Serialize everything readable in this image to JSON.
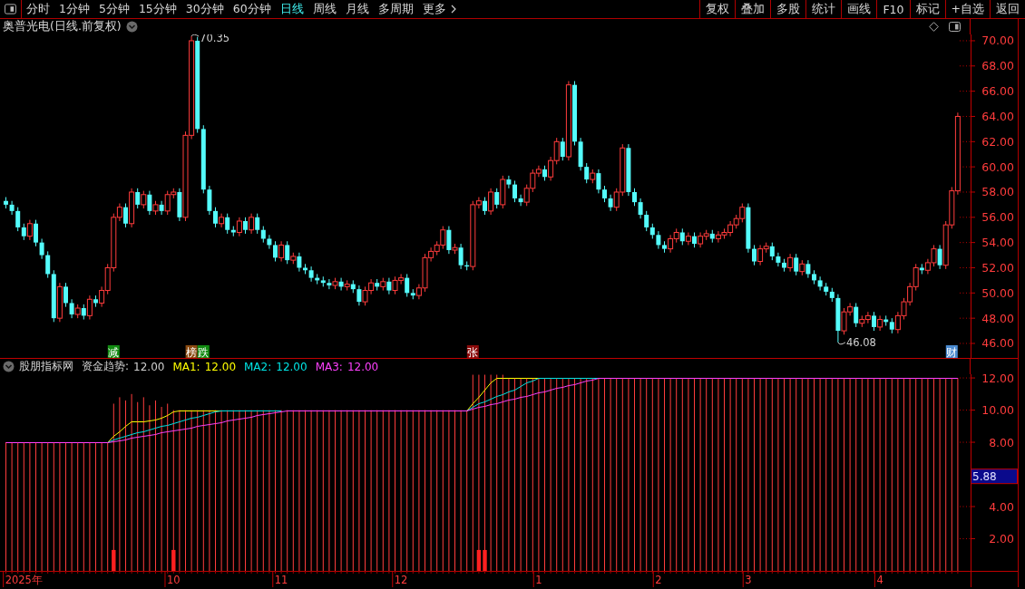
{
  "toolbar": {
    "periods": [
      {
        "label": "分时",
        "selected": false
      },
      {
        "label": "1分钟",
        "selected": false
      },
      {
        "label": "5分钟",
        "selected": false
      },
      {
        "label": "15分钟",
        "selected": false
      },
      {
        "label": "30分钟",
        "selected": false
      },
      {
        "label": "60分钟",
        "selected": false
      },
      {
        "label": "日线",
        "selected": true
      },
      {
        "label": "周线",
        "selected": false
      },
      {
        "label": "月线",
        "selected": false
      },
      {
        "label": "多周期",
        "selected": false
      },
      {
        "label": "更多",
        "selected": false
      }
    ],
    "buttons": [
      "复权",
      "叠加",
      "多股",
      "统计",
      "画线",
      "F10",
      "标记",
      "+自选",
      "返回"
    ]
  },
  "title": "奥普光电(日线.前复权)",
  "price_chart": {
    "chart_data": {
      "type": "candlestick",
      "ylim": [
        44.85,
        70.5
      ],
      "yticks": [
        {
          "value": 46,
          "label": "46.00"
        },
        {
          "value": 48,
          "label": "48.00"
        },
        {
          "value": 50,
          "label": "50.00"
        },
        {
          "value": 52,
          "label": "52.00"
        },
        {
          "value": 54,
          "label": "54.00"
        },
        {
          "value": 56,
          "label": "56.00"
        },
        {
          "value": 58,
          "label": "58.00"
        },
        {
          "value": 60,
          "label": "60.00"
        },
        {
          "value": 62,
          "label": "62.00"
        },
        {
          "value": 64,
          "label": "64.00"
        },
        {
          "value": 66,
          "label": "66.00"
        },
        {
          "value": 68,
          "label": "68.00"
        },
        {
          "value": 70,
          "label": "70.00"
        }
      ],
      "categories": [
        null,
        null,
        null,
        null,
        null,
        null,
        null,
        null,
        null,
        null,
        null,
        null,
        null,
        null,
        null,
        null,
        null,
        null,
        null,
        null,
        null,
        null,
        null,
        null,
        null,
        null,
        null,
        null,
        null,
        null,
        null,
        null,
        null,
        null,
        null,
        null,
        null,
        null,
        null,
        null,
        null,
        null,
        null,
        null,
        null,
        null,
        null,
        null,
        null,
        null,
        null,
        null,
        null,
        null,
        null,
        null,
        null,
        null,
        null,
        null,
        null,
        null,
        null,
        null,
        null,
        null,
        null,
        null,
        null,
        null,
        null,
        null,
        null,
        null,
        null,
        null,
        null,
        null,
        null,
        null,
        null,
        null,
        null,
        null,
        null,
        null,
        null,
        null,
        null,
        null,
        null,
        null,
        null,
        null,
        null,
        null,
        null,
        null,
        null,
        null,
        null,
        null,
        null,
        null,
        null,
        null,
        null,
        null,
        null,
        null,
        null,
        null,
        null,
        null,
        null,
        null,
        null,
        null,
        null,
        null,
        null,
        null,
        null,
        null,
        null,
        null,
        null,
        null,
        null,
        null,
        null,
        null,
        null,
        null,
        null,
        null,
        null,
        null,
        null,
        null,
        null,
        null,
        null,
        null,
        null,
        null,
        null,
        null,
        null,
        null,
        null,
        null,
        null,
        null,
        null,
        null,
        null,
        null,
        null,
        null
      ],
      "ohlc": [
        [
          57.3,
          57.6,
          56.7,
          57
        ],
        [
          57,
          57.3,
          56.2,
          56.5
        ],
        [
          56.5,
          56.8,
          54.9,
          55.2
        ],
        [
          55.2,
          55.5,
          54.2,
          54.5
        ],
        [
          54.5,
          55.8,
          54.2,
          55.5
        ],
        [
          55.5,
          55.8,
          53.7,
          54
        ],
        [
          54,
          54.3,
          52.7,
          53
        ],
        [
          53,
          53.3,
          51.2,
          51.5
        ],
        [
          51.5,
          51.8,
          47.7,
          48
        ],
        [
          48,
          50.8,
          47.7,
          50.5
        ],
        [
          50.5,
          50.8,
          48.9,
          49.2
        ],
        [
          49.2,
          49.5,
          48,
          48.3
        ],
        [
          48.3,
          49.1,
          48,
          48.8
        ],
        [
          48.8,
          49.1,
          47.9,
          48.2
        ],
        [
          48.2,
          49.8,
          47.9,
          49.5
        ],
        [
          49.5,
          49.8,
          48.9,
          49.2
        ],
        [
          49.2,
          50.5,
          48.9,
          50.2
        ],
        [
          50.2,
          52.3,
          49.9,
          52
        ],
        [
          52,
          56.3,
          51.7,
          56
        ],
        [
          56,
          57.1,
          55.7,
          56.8
        ],
        [
          56.8,
          57.1,
          55.2,
          55.5
        ],
        [
          55.5,
          58.3,
          55.2,
          58
        ],
        [
          58,
          58.3,
          56.7,
          57
        ],
        [
          57,
          58.1,
          56.7,
          57.8
        ],
        [
          57.8,
          58.1,
          56.2,
          56.5
        ],
        [
          56.5,
          57.3,
          56.2,
          57
        ],
        [
          57,
          57.3,
          56.2,
          56.5
        ],
        [
          56.5,
          58.1,
          56.2,
          57.8
        ],
        [
          57.8,
          58.3,
          57.5,
          58
        ],
        [
          58,
          58.3,
          55.7,
          56
        ],
        [
          56,
          62.8,
          55.7,
          62.5
        ],
        [
          62.5,
          70.35,
          62.2,
          70
        ],
        [
          70,
          70.3,
          62.7,
          63
        ],
        [
          63,
          63.3,
          57.9,
          58.2
        ],
        [
          58.2,
          58.5,
          56.2,
          56.5
        ],
        [
          56.5,
          56.8,
          55.2,
          55.5
        ],
        [
          55.5,
          56.3,
          55.2,
          56
        ],
        [
          56,
          56.3,
          54.7,
          55
        ],
        [
          55,
          55.3,
          54.5,
          54.8
        ],
        [
          54.8,
          56,
          54.5,
          55.7
        ],
        [
          55.7,
          56,
          54.7,
          55
        ],
        [
          55,
          56.3,
          54.7,
          56
        ],
        [
          56,
          56.3,
          54.7,
          55
        ],
        [
          55,
          55.3,
          54,
          54.3
        ],
        [
          54.3,
          54.6,
          53.5,
          53.8
        ],
        [
          53.8,
          54.1,
          52.5,
          52.8
        ],
        [
          52.8,
          54.1,
          52.5,
          53.8
        ],
        [
          53.8,
          54.1,
          52.3,
          52.6
        ],
        [
          52.6,
          53.2,
          52.3,
          52.9
        ],
        [
          52.9,
          53.2,
          51.7,
          52
        ],
        [
          52,
          52.3,
          51.5,
          51.8
        ],
        [
          51.8,
          52.1,
          50.9,
          51.2
        ],
        [
          51.2,
          51.5,
          50.7,
          51
        ],
        [
          51,
          51.3,
          50.5,
          50.8
        ],
        [
          50.8,
          51.1,
          50.3,
          50.6
        ],
        [
          50.6,
          51.2,
          50.3,
          50.9
        ],
        [
          50.9,
          51.2,
          50.2,
          50.5
        ],
        [
          50.5,
          51,
          50.2,
          50.7
        ],
        [
          50.7,
          51,
          50,
          50.3
        ],
        [
          50.3,
          50.6,
          49,
          49.3
        ],
        [
          49.3,
          50.5,
          49,
          50.2
        ],
        [
          50.2,
          51.1,
          49.9,
          50.8
        ],
        [
          50.8,
          51.1,
          50.2,
          50.5
        ],
        [
          50.5,
          51.2,
          50.2,
          50.9
        ],
        [
          50.9,
          51.2,
          49.9,
          50.2
        ],
        [
          50.2,
          51.3,
          49.9,
          51
        ],
        [
          51,
          51.5,
          50.7,
          51.2
        ],
        [
          51.2,
          51.5,
          49.7,
          50
        ],
        [
          50,
          50.3,
          49.5,
          49.8
        ],
        [
          49.8,
          50.7,
          49.5,
          50.4
        ],
        [
          50.4,
          53.1,
          50.1,
          52.8
        ],
        [
          52.8,
          53.6,
          52.5,
          53.3
        ],
        [
          53.3,
          54.1,
          53,
          53.8
        ],
        [
          53.8,
          55.3,
          53.5,
          55
        ],
        [
          55,
          55.3,
          53.1,
          53.4
        ],
        [
          53.4,
          53.9,
          53.1,
          53.6
        ],
        [
          53.6,
          53.9,
          51.9,
          52.2
        ],
        [
          52.2,
          52.5,
          51.8,
          52.1
        ],
        [
          52.1,
          57.3,
          51.8,
          57
        ],
        [
          57,
          57.6,
          56.7,
          57.3
        ],
        [
          57.3,
          57.6,
          56.2,
          56.5
        ],
        [
          56.5,
          58.3,
          56.2,
          58
        ],
        [
          58,
          58.3,
          56.7,
          57
        ],
        [
          57,
          59.3,
          56.7,
          59
        ],
        [
          59,
          59.3,
          58.3,
          58.6
        ],
        [
          58.6,
          58.9,
          57.2,
          57.5
        ],
        [
          57.5,
          57.8,
          56.9,
          57.2
        ],
        [
          57.2,
          58.6,
          56.9,
          58.3
        ],
        [
          58.3,
          59.8,
          58,
          59.5
        ],
        [
          59.5,
          60.1,
          59.2,
          59.8
        ],
        [
          59.8,
          60.1,
          58.9,
          59.2
        ],
        [
          59.2,
          60.8,
          58.9,
          60.5
        ],
        [
          60.5,
          62.3,
          60.2,
          62
        ],
        [
          62,
          62.3,
          60.5,
          60.8
        ],
        [
          60.8,
          66.8,
          60.5,
          66.5
        ],
        [
          66.5,
          66.8,
          61.7,
          62
        ],
        [
          62,
          62.3,
          59.7,
          60
        ],
        [
          60,
          60.3,
          58.7,
          59
        ],
        [
          59,
          59.8,
          58.7,
          59.5
        ],
        [
          59.5,
          59.8,
          57.9,
          58.2
        ],
        [
          58.2,
          58.5,
          57.2,
          57.5
        ],
        [
          57.5,
          57.8,
          56.5,
          56.8
        ],
        [
          56.8,
          58.3,
          56.5,
          58
        ],
        [
          58,
          61.8,
          57.7,
          61.5
        ],
        [
          61.5,
          61.8,
          57.7,
          58
        ],
        [
          58,
          58.3,
          56.9,
          57.2
        ],
        [
          57.2,
          57.5,
          55.9,
          56.2
        ],
        [
          56.2,
          56.5,
          54.9,
          55.2
        ],
        [
          55.2,
          55.5,
          54.3,
          54.6
        ],
        [
          54.6,
          54.9,
          53.5,
          53.8
        ],
        [
          53.8,
          54.1,
          53.2,
          53.5
        ],
        [
          53.5,
          54.6,
          53.2,
          54.3
        ],
        [
          54.3,
          55.1,
          54,
          54.8
        ],
        [
          54.8,
          55.1,
          53.8,
          54.1
        ],
        [
          54.1,
          54.8,
          53.8,
          54.5
        ],
        [
          54.5,
          54.8,
          53.6,
          53.9
        ],
        [
          53.9,
          54.8,
          53.6,
          54.5
        ],
        [
          54.5,
          55,
          54.2,
          54.7
        ],
        [
          54.7,
          55,
          54,
          54.3
        ],
        [
          54.3,
          54.9,
          54,
          54.6
        ],
        [
          54.6,
          55.1,
          54.3,
          54.8
        ],
        [
          54.8,
          55.7,
          54.5,
          55.4
        ],
        [
          55.4,
          56.2,
          55.1,
          55.9
        ],
        [
          55.9,
          57.1,
          55.6,
          56.8
        ],
        [
          56.8,
          57.1,
          53.2,
          53.5
        ],
        [
          53.5,
          53.8,
          52.2,
          52.5
        ],
        [
          52.5,
          53.8,
          52.2,
          53.5
        ],
        [
          53.5,
          54,
          53.2,
          53.7
        ],
        [
          53.7,
          54,
          52.6,
          52.9
        ],
        [
          52.9,
          53.2,
          52.1,
          52.4
        ],
        [
          52.4,
          52.7,
          51.7,
          52
        ],
        [
          52,
          53.1,
          51.7,
          52.8
        ],
        [
          52.8,
          53.1,
          51.4,
          51.7
        ],
        [
          51.7,
          52.6,
          51.4,
          52.3
        ],
        [
          52.3,
          52.6,
          51.2,
          51.5
        ],
        [
          51.5,
          51.8,
          50.7,
          51
        ],
        [
          51,
          51.3,
          50.2,
          50.5
        ],
        [
          50.5,
          50.8,
          49.8,
          50.1
        ],
        [
          50.1,
          50.4,
          49.3,
          49.6
        ],
        [
          49.6,
          49.9,
          46.08,
          47
        ],
        [
          47,
          48.8,
          46.7,
          48.5
        ],
        [
          48.5,
          49.2,
          48.2,
          48.9
        ],
        [
          48.9,
          49.2,
          47.3,
          47.6
        ],
        [
          47.6,
          48.2,
          47.3,
          47.9
        ],
        [
          47.9,
          48.5,
          47.6,
          48.2
        ],
        [
          48.2,
          48.5,
          47,
          47.3
        ],
        [
          47.3,
          48.2,
          47,
          47.9
        ],
        [
          47.9,
          48.2,
          47.4,
          47.7
        ],
        [
          47.7,
          48,
          46.8,
          47.1
        ],
        [
          47.1,
          48.5,
          46.8,
          48.2
        ],
        [
          48.2,
          49.6,
          47.9,
          49.3
        ],
        [
          49.3,
          50.8,
          49,
          50.5
        ],
        [
          50.5,
          52.3,
          50.2,
          52
        ],
        [
          52,
          52.3,
          51.5,
          51.8
        ],
        [
          51.8,
          52.7,
          51.5,
          52.4
        ],
        [
          52.4,
          53.8,
          52.1,
          53.5
        ],
        [
          53.5,
          53.8,
          51.9,
          52.2
        ],
        [
          52.2,
          55.7,
          51.9,
          55.4
        ],
        [
          55.4,
          58.4,
          55.1,
          58.1
        ],
        [
          58.1,
          64.3,
          57.8,
          64
        ]
      ],
      "annotations": [
        "70.35",
        "46.08"
      ]
    },
    "tags": [
      {
        "text": "减",
        "color": "#108a10"
      },
      {
        "text": "榜",
        "color": "#8a4a10"
      },
      {
        "text": "跌",
        "color": "#108a10"
      },
      {
        "text": "张",
        "color": "#8a0a0a"
      },
      {
        "text": "财",
        "color": "#4a8ad0"
      }
    ]
  },
  "indicator": {
    "name": "股朋指标网",
    "legend": [
      {
        "label": "资金趋势:",
        "value": "12.00"
      },
      {
        "label": "MA1:",
        "value": "12.00",
        "color": "#ffff00"
      },
      {
        "label": "MA2:",
        "value": "12.00",
        "color": "#00e5e5"
      },
      {
        "label": "MA3:",
        "value": "12.00",
        "color": "#ff40ff"
      }
    ],
    "chart_data": {
      "type": "bar",
      "ylim": [
        0,
        12.23
      ],
      "yticks": [
        {
          "value": 2,
          "label": "2.00"
        },
        {
          "value": 4,
          "label": "4.00"
        },
        {
          "value": 8,
          "label": "8.00"
        },
        {
          "value": 10,
          "label": "10.00"
        },
        {
          "value": 12,
          "label": "12.00"
        }
      ],
      "categories": [
        null,
        null,
        null,
        "2025年",
        null,
        null,
        null,
        null,
        null,
        null,
        null,
        null,
        null,
        null,
        null,
        null,
        null,
        null,
        null,
        null,
        null,
        null,
        null,
        null,
        null,
        null,
        null,
        null,
        "10",
        null,
        null,
        null,
        null,
        null,
        null,
        null,
        null,
        null,
        null,
        null,
        null,
        null,
        null,
        null,
        null,
        null,
        "11",
        null,
        null,
        null,
        null,
        null,
        null,
        null,
        null,
        null,
        null,
        null,
        null,
        null,
        null,
        null,
        null,
        null,
        null,
        null,
        "12",
        null,
        null,
        null,
        null,
        null,
        null,
        null,
        null,
        null,
        null,
        null,
        null,
        null,
        null,
        null,
        null,
        null,
        null,
        null,
        null,
        null,
        null,
        "1",
        null,
        null,
        null,
        null,
        null,
        null,
        null,
        null,
        null,
        null,
        null,
        null,
        null,
        null,
        null,
        null,
        null,
        null,
        null,
        "2",
        null,
        null,
        null,
        null,
        null,
        null,
        null,
        null,
        null,
        null,
        null,
        null,
        null,
        null,
        "3",
        null,
        null,
        null,
        null,
        null,
        null,
        null,
        null,
        null,
        null,
        null,
        null,
        null,
        null,
        null,
        null,
        null,
        null,
        null,
        null,
        null,
        "4",
        null,
        null,
        null,
        null,
        null,
        null,
        null,
        null,
        null,
        null,
        null,
        null,
        null
      ],
      "series": [
        {
          "color": "#ff3c3c",
          "values": [
            8,
            8,
            8,
            8,
            8,
            8,
            8,
            8,
            8,
            8,
            8,
            8,
            8,
            8,
            8,
            8,
            8,
            8,
            10.4,
            10.8,
            10.6,
            11,
            10.5,
            10.8,
            10.3,
            10.6,
            10.2,
            10.4,
            10,
            10,
            10,
            10,
            10,
            10,
            10,
            10,
            10,
            10,
            10,
            10,
            10,
            10,
            10,
            10,
            10,
            10,
            10,
            10,
            10,
            10,
            10,
            10,
            10,
            10,
            10,
            10,
            10,
            10,
            10,
            10,
            10,
            10,
            10,
            10,
            10,
            10,
            10,
            10,
            10,
            10,
            10,
            10,
            10,
            10,
            10,
            10,
            10,
            10,
            12.2,
            12.2,
            12.2,
            12.2,
            12.2,
            12.2,
            12,
            12,
            12,
            12,
            12,
            12,
            12,
            12,
            12,
            12,
            12,
            12,
            12,
            12,
            12,
            12,
            12,
            12,
            12,
            12,
            12,
            12,
            12,
            12,
            12,
            12,
            12,
            12,
            12,
            12,
            12,
            12,
            12,
            12,
            12,
            12,
            12,
            12,
            12,
            12,
            12,
            12,
            12,
            12,
            12,
            12,
            12,
            12,
            12,
            12,
            12,
            12,
            12,
            12,
            12,
            12,
            12,
            12,
            12,
            12,
            12,
            12,
            12,
            12,
            12,
            12,
            12,
            12,
            12,
            12,
            12,
            12,
            12,
            12,
            12,
            12
          ]
        },
        {
          "type": "line",
          "color": "#ffff00",
          "values": [
            null,
            null,
            null,
            null,
            null,
            null,
            null,
            null,
            null,
            null,
            null,
            null,
            null,
            null,
            null,
            null,
            null,
            8,
            8.4,
            8.7,
            9,
            9.3,
            9.3,
            9.3,
            9.35,
            9.4,
            9.5,
            9.7,
            9.9,
            10,
            10,
            10,
            10,
            10,
            10,
            10,
            10,
            null,
            null,
            null,
            null,
            null,
            null,
            null,
            null,
            null,
            null,
            null,
            null,
            null,
            null,
            null,
            null,
            null,
            null,
            null,
            null,
            null,
            null,
            null,
            null,
            null,
            null,
            null,
            null,
            null,
            null,
            null,
            null,
            null,
            null,
            null,
            null,
            null,
            null,
            null,
            null,
            10,
            10.4,
            10.8,
            11.3,
            11.7,
            12,
            12,
            12,
            12,
            12,
            12,
            12,
            12,
            null,
            null,
            null,
            null,
            null,
            null,
            null,
            null,
            null,
            null,
            null,
            null,
            null,
            null,
            null,
            null,
            null,
            null,
            null,
            null,
            null,
            null,
            null,
            null,
            null,
            null,
            null,
            null,
            null,
            null,
            null,
            null,
            null,
            null,
            null,
            null,
            null,
            null,
            null,
            null,
            null,
            null,
            null,
            null,
            null,
            null,
            null,
            null,
            null,
            null,
            null,
            null,
            null,
            null,
            null,
            null,
            null,
            null,
            null,
            null,
            null,
            null,
            null,
            null,
            null,
            null,
            null,
            null,
            null,
            null
          ]
        },
        {
          "type": "line",
          "color": "#00e5e5",
          "values": [
            null,
            null,
            null,
            null,
            null,
            null,
            null,
            null,
            null,
            null,
            null,
            null,
            null,
            null,
            null,
            null,
            null,
            8,
            8.2,
            8.3,
            8.4,
            8.5,
            8.6,
            8.7,
            8.8,
            8.9,
            9,
            9.1,
            9.2,
            9.3,
            9.4,
            9.5,
            9.6,
            9.7,
            9.8,
            9.9,
            9.95,
            10,
            10,
            10,
            10,
            10,
            10,
            10,
            10,
            10,
            10,
            null,
            null,
            null,
            null,
            null,
            null,
            null,
            null,
            null,
            null,
            null,
            null,
            null,
            null,
            null,
            null,
            null,
            null,
            null,
            null,
            null,
            null,
            null,
            null,
            null,
            null,
            null,
            null,
            null,
            null,
            10,
            10.2,
            10.4,
            10.55,
            10.7,
            10.85,
            11,
            11.15,
            11.3,
            11.5,
            11.7,
            11.85,
            12,
            12,
            12,
            12,
            12,
            12,
            12,
            12,
            12,
            12,
            12,
            null,
            null,
            null,
            null,
            null,
            null,
            null,
            null,
            null,
            null,
            null,
            null,
            null,
            null,
            null,
            null,
            null,
            null,
            null,
            null,
            null,
            null,
            null,
            null,
            null,
            null,
            null,
            null,
            null,
            null,
            null,
            null,
            null,
            null,
            null,
            null,
            null,
            null,
            null,
            null,
            null,
            null,
            null,
            null,
            null,
            null,
            null,
            null,
            null,
            null,
            null,
            null,
            null,
            null,
            null,
            null,
            null,
            null,
            null,
            null
          ]
        },
        {
          "type": "line",
          "color": "#ff40ff",
          "values": [
            8,
            8,
            8,
            8,
            8,
            8,
            8,
            8,
            8,
            8,
            8,
            8,
            8,
            8,
            8,
            8,
            8,
            8,
            8.07,
            8.13,
            8.2,
            8.27,
            8.33,
            8.4,
            8.47,
            8.53,
            8.6,
            8.67,
            8.73,
            8.8,
            8.87,
            8.93,
            9,
            9.07,
            9.13,
            9.2,
            9.27,
            9.33,
            9.4,
            9.47,
            9.53,
            9.6,
            9.67,
            9.73,
            9.8,
            9.87,
            9.93,
            10,
            10,
            10,
            10,
            10,
            10,
            10,
            10,
            10,
            10,
            10,
            10,
            10,
            10,
            10,
            10,
            10,
            10,
            10,
            10,
            10,
            10,
            10,
            10,
            10,
            10,
            10,
            10,
            10,
            10,
            10,
            10.09,
            10.18,
            10.27,
            10.36,
            10.45,
            10.54,
            10.63,
            10.72,
            10.81,
            10.9,
            11,
            11.09,
            11.18,
            11.27,
            11.36,
            11.45,
            11.54,
            11.63,
            11.72,
            11.81,
            11.9,
            12,
            12,
            12,
            12,
            12,
            12,
            12,
            12,
            12,
            12,
            12,
            12,
            12,
            12,
            12,
            12,
            12,
            12,
            12,
            12,
            12,
            12,
            12,
            12,
            12,
            12,
            12,
            12,
            12,
            12,
            12,
            12,
            12,
            12,
            12,
            12,
            12,
            12,
            12,
            12,
            12,
            12,
            12,
            12,
            12,
            12,
            12,
            12,
            12,
            12,
            12,
            12,
            12,
            12,
            12,
            12,
            12,
            12,
            12,
            12,
            12
          ]
        },
        {
          "color": "#ff2020",
          "values": [
            null,
            null,
            null,
            null,
            null,
            null,
            null,
            null,
            null,
            null,
            null,
            null,
            null,
            null,
            null,
            null,
            null,
            null,
            1.3,
            null,
            null,
            null,
            null,
            null,
            null,
            null,
            null,
            null,
            1.3,
            null,
            null,
            null,
            null,
            null,
            null,
            null,
            null,
            null,
            null,
            null,
            null,
            null,
            null,
            null,
            null,
            null,
            null,
            null,
            null,
            null,
            null,
            null,
            null,
            null,
            null,
            null,
            null,
            null,
            null,
            null,
            null,
            null,
            null,
            null,
            null,
            null,
            null,
            null,
            null,
            null,
            null,
            null,
            null,
            null,
            null,
            null,
            null,
            null,
            null,
            1.3,
            1.3,
            null,
            null,
            null,
            null,
            null,
            null,
            null,
            null,
            null,
            null,
            null,
            null,
            null,
            null,
            null,
            null,
            null,
            null,
            null,
            null,
            null,
            null,
            null,
            null,
            null,
            null,
            null,
            null,
            null,
            null,
            null,
            null,
            null,
            null,
            null,
            null,
            null,
            null,
            null,
            null,
            null,
            null,
            null,
            null,
            null,
            null,
            null,
            null,
            null,
            null,
            null,
            null,
            null,
            null,
            null,
            null,
            null,
            null,
            null,
            null,
            null,
            null,
            null,
            null,
            null,
            null,
            null,
            null,
            null,
            null,
            null,
            null,
            null,
            null,
            null,
            null,
            null,
            null,
            null
          ]
        }
      ]
    },
    "cursor_value": {
      "text": "5.88"
    }
  }
}
